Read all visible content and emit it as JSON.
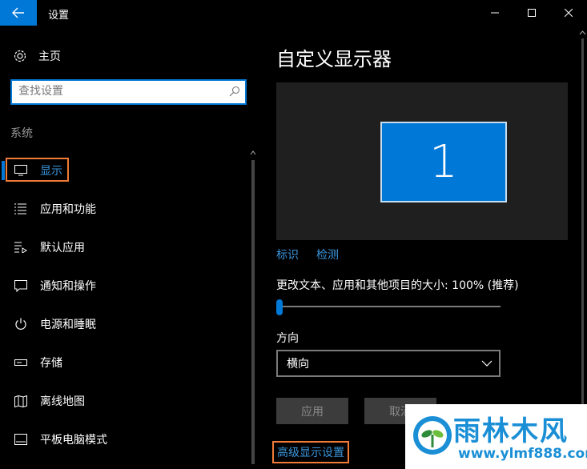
{
  "window": {
    "title": "设置"
  },
  "sidebar": {
    "home_label": "主页",
    "search": {
      "placeholder": "查找设置",
      "value": ""
    },
    "section_label": "系统",
    "items": [
      {
        "label": "显示",
        "icon": "monitor-icon",
        "active": true
      },
      {
        "label": "应用和功能",
        "icon": "list-icon"
      },
      {
        "label": "默认应用",
        "icon": "default-apps-icon"
      },
      {
        "label": "通知和操作",
        "icon": "notification-icon"
      },
      {
        "label": "电源和睡眠",
        "icon": "power-icon"
      },
      {
        "label": "存储",
        "icon": "storage-icon"
      },
      {
        "label": "离线地图",
        "icon": "map-icon"
      },
      {
        "label": "平板电脑模式",
        "icon": "tablet-mode-icon"
      }
    ]
  },
  "main": {
    "title": "自定义显示器",
    "monitor_number": "1",
    "identify_link": "标识",
    "detect_link": "检测",
    "scale_label": "更改文本、应用和其他项目的大小: 100% (推荐)",
    "scale_percent": 100,
    "slider_fraction": 0,
    "orientation_label": "方向",
    "orientation_value": "横向",
    "apply_button": "应用",
    "cancel_button": "取消",
    "advanced_link": "高级显示设置"
  },
  "watermark": {
    "title": "雨林木风",
    "url": "www.ylmf888.com"
  },
  "colors": {
    "accent": "#0078d7",
    "link": "#3a96dd",
    "highlight_box": "#f27b37"
  }
}
